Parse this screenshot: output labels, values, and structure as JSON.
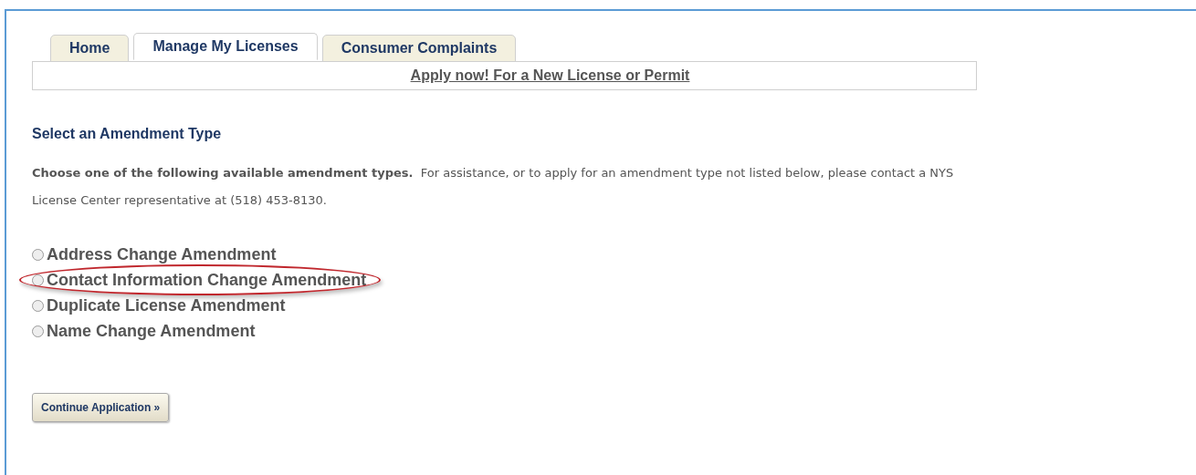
{
  "tabs": [
    {
      "label": "Home",
      "selected": false
    },
    {
      "label": "Manage My Licenses",
      "selected": true
    },
    {
      "label": "Consumer Complaints",
      "selected": false
    }
  ],
  "apply_link": "Apply now! For a New License or Permit",
  "heading": "Select an Amendment Type",
  "intro": "**Choose one of the following available amendment types.**  For assistance, or to apply for an amendment type not listed below, please contact a NYS License Center representative at (518) 453-8130.",
  "options": [
    {
      "label": "Address Change Amendment",
      "selected": false,
      "highlighted": false
    },
    {
      "label": "Contact Information Change Amendment",
      "selected": false,
      "highlighted": true
    },
    {
      "label": "Duplicate License Amendment",
      "selected": false,
      "highlighted": false
    },
    {
      "label": "Name Change Amendment",
      "selected": false,
      "highlighted": false
    }
  ],
  "continue_button": "Continue Application »"
}
